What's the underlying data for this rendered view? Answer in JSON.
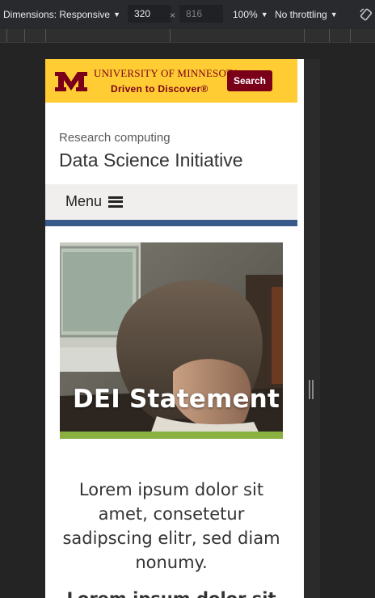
{
  "devtools": {
    "dimensions_label": "Dimensions: Responsive",
    "width_value": "320",
    "height_value": "816",
    "times": "×",
    "zoom_label": "100%",
    "throttling_label": "No throttling",
    "rotate_icon": "rotate-icon"
  },
  "site": {
    "university_name": "UNIVERSITY OF MINNESOTA",
    "tagline": "Driven to Discover®",
    "search_label": "Search",
    "subtitle": "Research computing",
    "title": "Data Science Initiative",
    "menu_label": "Menu",
    "hero_title": "DEI Statement",
    "lede": "Lorem ipsum dolor sit amet, consetetur sadipscing elitr, sed diam nonumy.",
    "next_heading_partial": "Lorem ipsum dolor sit"
  },
  "colors": {
    "umn_gold": "#ffcc33",
    "umn_maroon": "#7a0019",
    "stripe_blue": "#385b8b",
    "hero_green": "#8ab040"
  }
}
